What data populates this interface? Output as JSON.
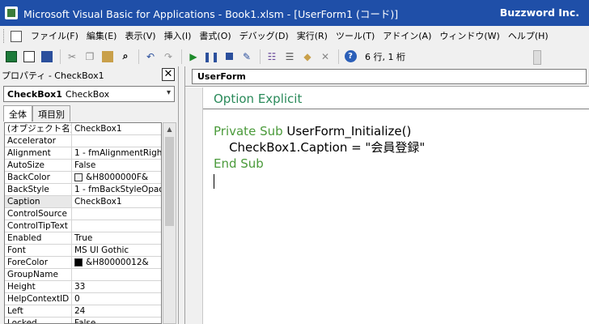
{
  "window": {
    "title": "Microsoft Visual Basic for Applications - Book1.xlsm - [UserForm1 (コード)]",
    "brand": "Buzzword Inc."
  },
  "menu": [
    "ファイル(F)",
    "編集(E)",
    "表示(V)",
    "挿入(I)",
    "書式(O)",
    "デバッグ(D)",
    "実行(R)",
    "ツール(T)",
    "アドイン(A)",
    "ウィンドウ(W)",
    "ヘルプ(H)"
  ],
  "toolbar": {
    "status": "6 行, 1 桁"
  },
  "properties": {
    "header": "プロパティ - CheckBox1",
    "object_name": "CheckBox1",
    "object_type": "CheckBox",
    "tabs": [
      "全体",
      "項目別"
    ],
    "rows": [
      {
        "name": "(オブジェクト名)",
        "value": "CheckBox1"
      },
      {
        "name": "Accelerator",
        "value": ""
      },
      {
        "name": "Alignment",
        "value": "1 - fmAlignmentRigh"
      },
      {
        "name": "AutoSize",
        "value": "False"
      },
      {
        "name": "BackColor",
        "value": "&H8000000F&",
        "swatch": "#f0f0f0"
      },
      {
        "name": "BackStyle",
        "value": "1 - fmBackStyleOpac"
      },
      {
        "name": "Caption",
        "value": "CheckBox1"
      },
      {
        "name": "ControlSource",
        "value": ""
      },
      {
        "name": "ControlTipText",
        "value": ""
      },
      {
        "name": "Enabled",
        "value": "True"
      },
      {
        "name": "Font",
        "value": "MS UI Gothic"
      },
      {
        "name": "ForeColor",
        "value": "&H80000012&",
        "swatch": "#000000"
      },
      {
        "name": "GroupName",
        "value": ""
      },
      {
        "name": "Height",
        "value": "33"
      },
      {
        "name": "HelpContextID",
        "value": "0"
      },
      {
        "name": "Left",
        "value": "24"
      },
      {
        "name": "Locked",
        "value": "False"
      }
    ]
  },
  "code": {
    "object": "UserForm",
    "option_kw": "Option Explicit",
    "sub_kw": "Private Sub",
    "sub_name": " UserForm_Initialize()",
    "stmt": "    CheckBox1.Caption = \"会員登録\"",
    "end_kw": "End Sub"
  }
}
